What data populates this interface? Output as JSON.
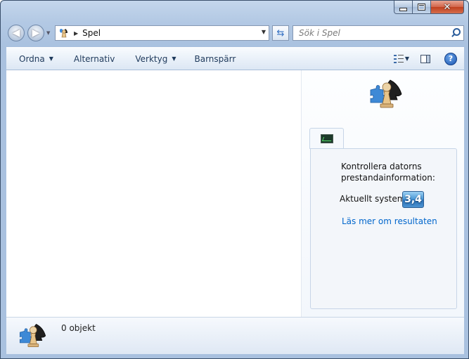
{
  "window": {
    "title": "Spel"
  },
  "address_bar": {
    "location": "Spel"
  },
  "search": {
    "placeholder": "Sök i Spel"
  },
  "command_bar": {
    "organize": "Ordna",
    "options": "Alternativ",
    "tools": "Verktyg",
    "parental_controls": "Barnspärr"
  },
  "side_pane": {
    "heading": "Kontrollera datorns prestandainformation:",
    "current_system_label": "Aktuellt system",
    "score": "3,4",
    "results_link": "Läs mer om resultaten"
  },
  "details_pane": {
    "item_count": "0 objekt"
  },
  "icons": {
    "back": "back-arrow-icon",
    "forward": "forward-arrow-icon",
    "location": "games-folder-icon",
    "refresh": "refresh-icon",
    "search": "search-icon",
    "views": "views-icon",
    "preview_pane": "preview-pane-icon",
    "help": "help-icon",
    "games": "games-chess-puzzle-icon",
    "performance": "performance-monitor-icon"
  },
  "colors": {
    "link": "#0066cc",
    "score_badge": "#3a85c8"
  }
}
